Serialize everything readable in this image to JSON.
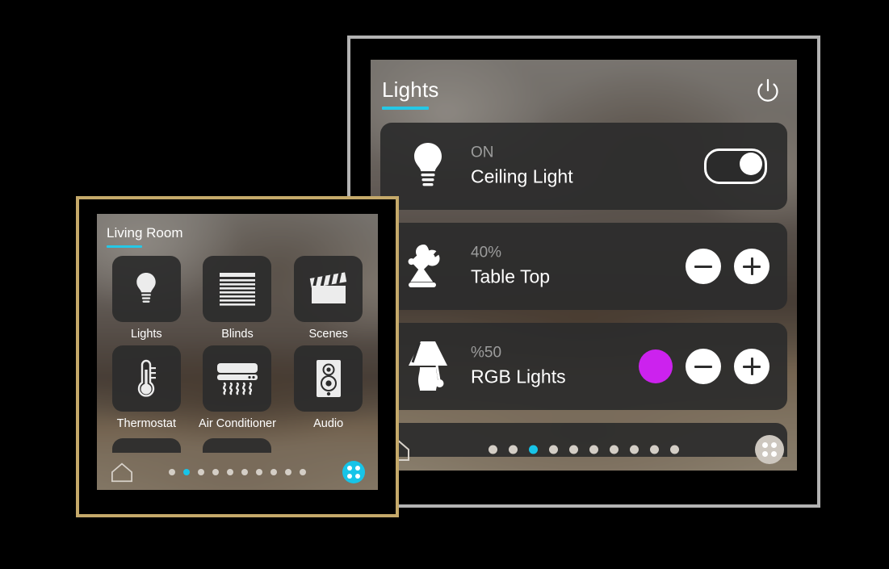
{
  "background": {
    "color": "#000000"
  },
  "panels": {
    "lights": {
      "frame_color": "#b3b3b3",
      "accent_color": "#25c8e6",
      "header": {
        "title": "Lights",
        "power_icon": "power-icon"
      },
      "cards": [
        {
          "icon": "bulb-icon",
          "state": "ON",
          "name": "Ceiling Light",
          "control": "toggle",
          "toggle_on": true
        },
        {
          "icon": "desk-lamp-icon",
          "state": "40%",
          "name": "Table Top",
          "control": "stepper",
          "minus_label": "−",
          "plus_label": "+"
        },
        {
          "icon": "table-lamp-icon",
          "state": "%50",
          "name": "RGB Lights",
          "control": "stepper-color",
          "color": "#cc22ee",
          "minus_label": "−",
          "plus_label": "+"
        }
      ],
      "bottom_bar": {
        "home_icon": "home-icon",
        "apps_icon": "apps-grid-icon",
        "apps_accent": false,
        "page_count": 10,
        "active_page": 3
      }
    },
    "room": {
      "frame_color": "#c5a96a",
      "accent_color": "#25c8e6",
      "header": {
        "title": "Living Room"
      },
      "tiles": [
        {
          "icon": "bulb-icon",
          "label": "Lights"
        },
        {
          "icon": "blinds-icon",
          "label": "Blinds"
        },
        {
          "icon": "clapper-icon",
          "label": "Scenes"
        },
        {
          "icon": "thermometer-icon",
          "label": "Thermostat"
        },
        {
          "icon": "ac-icon",
          "label": "Air Conditioner"
        },
        {
          "icon": "speaker-icon",
          "label": "Audio"
        }
      ],
      "bottom_bar": {
        "home_icon": "home-icon",
        "apps_icon": "apps-grid-icon",
        "apps_accent": true,
        "page_count": 10,
        "active_page": 2
      }
    }
  }
}
